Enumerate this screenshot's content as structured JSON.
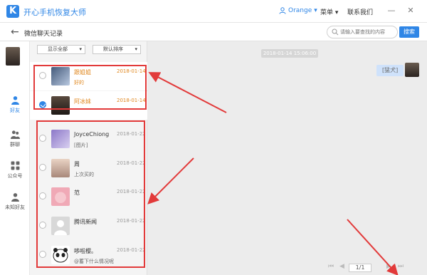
{
  "app": {
    "logo_letter": "K",
    "title": "开心手机恢复大师"
  },
  "header": {
    "user": "Orange",
    "user_caret": "▾",
    "menu": "菜单 ▾",
    "contact": "联系我们",
    "min": "—",
    "close": "✕"
  },
  "toolbar": {
    "back": "←",
    "title": "微信聊天记录",
    "search_placeholder": "请输入要查找的内容",
    "search_button": "搜索"
  },
  "nav": [
    {
      "label": "好友",
      "icon": "person-icon"
    },
    {
      "label": "群聊",
      "icon": "group-icon"
    },
    {
      "label": "公众号",
      "icon": "grid-icon"
    },
    {
      "label": "未知好友",
      "icon": "unknown-user-icon"
    }
  ],
  "filters": {
    "show": "显示全部",
    "sort": "默认排序",
    "caret": "▾"
  },
  "contacts": [
    {
      "name": "跟姐姐",
      "msg": "好的",
      "date": "2018-01-14",
      "highlight": true,
      "checked": false
    },
    {
      "name": "阿冰妹",
      "msg": "",
      "date": "2018-01-14",
      "highlight": true,
      "checked": true
    },
    {
      "name": "JoyceChiong",
      "msg": "[图片]",
      "date": "2018-01-22",
      "highlight": false,
      "checked": false
    },
    {
      "name": "周",
      "msg": "上次买的",
      "date": "2018-01-22",
      "highlight": false,
      "checked": false
    },
    {
      "name": "范",
      "msg": "",
      "date": "2018-01-22",
      "highlight": false,
      "checked": false
    },
    {
      "name": "腾讯新闻",
      "msg": "",
      "date": "2018-01-22",
      "highlight": false,
      "checked": false
    },
    {
      "name": "哆啦樱。",
      "msg": "@蓄下什么情况呢",
      "date": "2018-01-22",
      "highlight": false,
      "checked": false
    }
  ],
  "chat": {
    "timestamp": "2018-01-14 15:06:00",
    "bubble": "[猛犬]"
  },
  "pager": {
    "page": "1/1",
    "prev_first": "⏮",
    "prev": "◀",
    "next": "▶",
    "next_last": "⏭"
  },
  "colors": {
    "accent": "#2f86e6",
    "highlight_text": "#e08820",
    "annotation_red": "#e23a3a"
  }
}
